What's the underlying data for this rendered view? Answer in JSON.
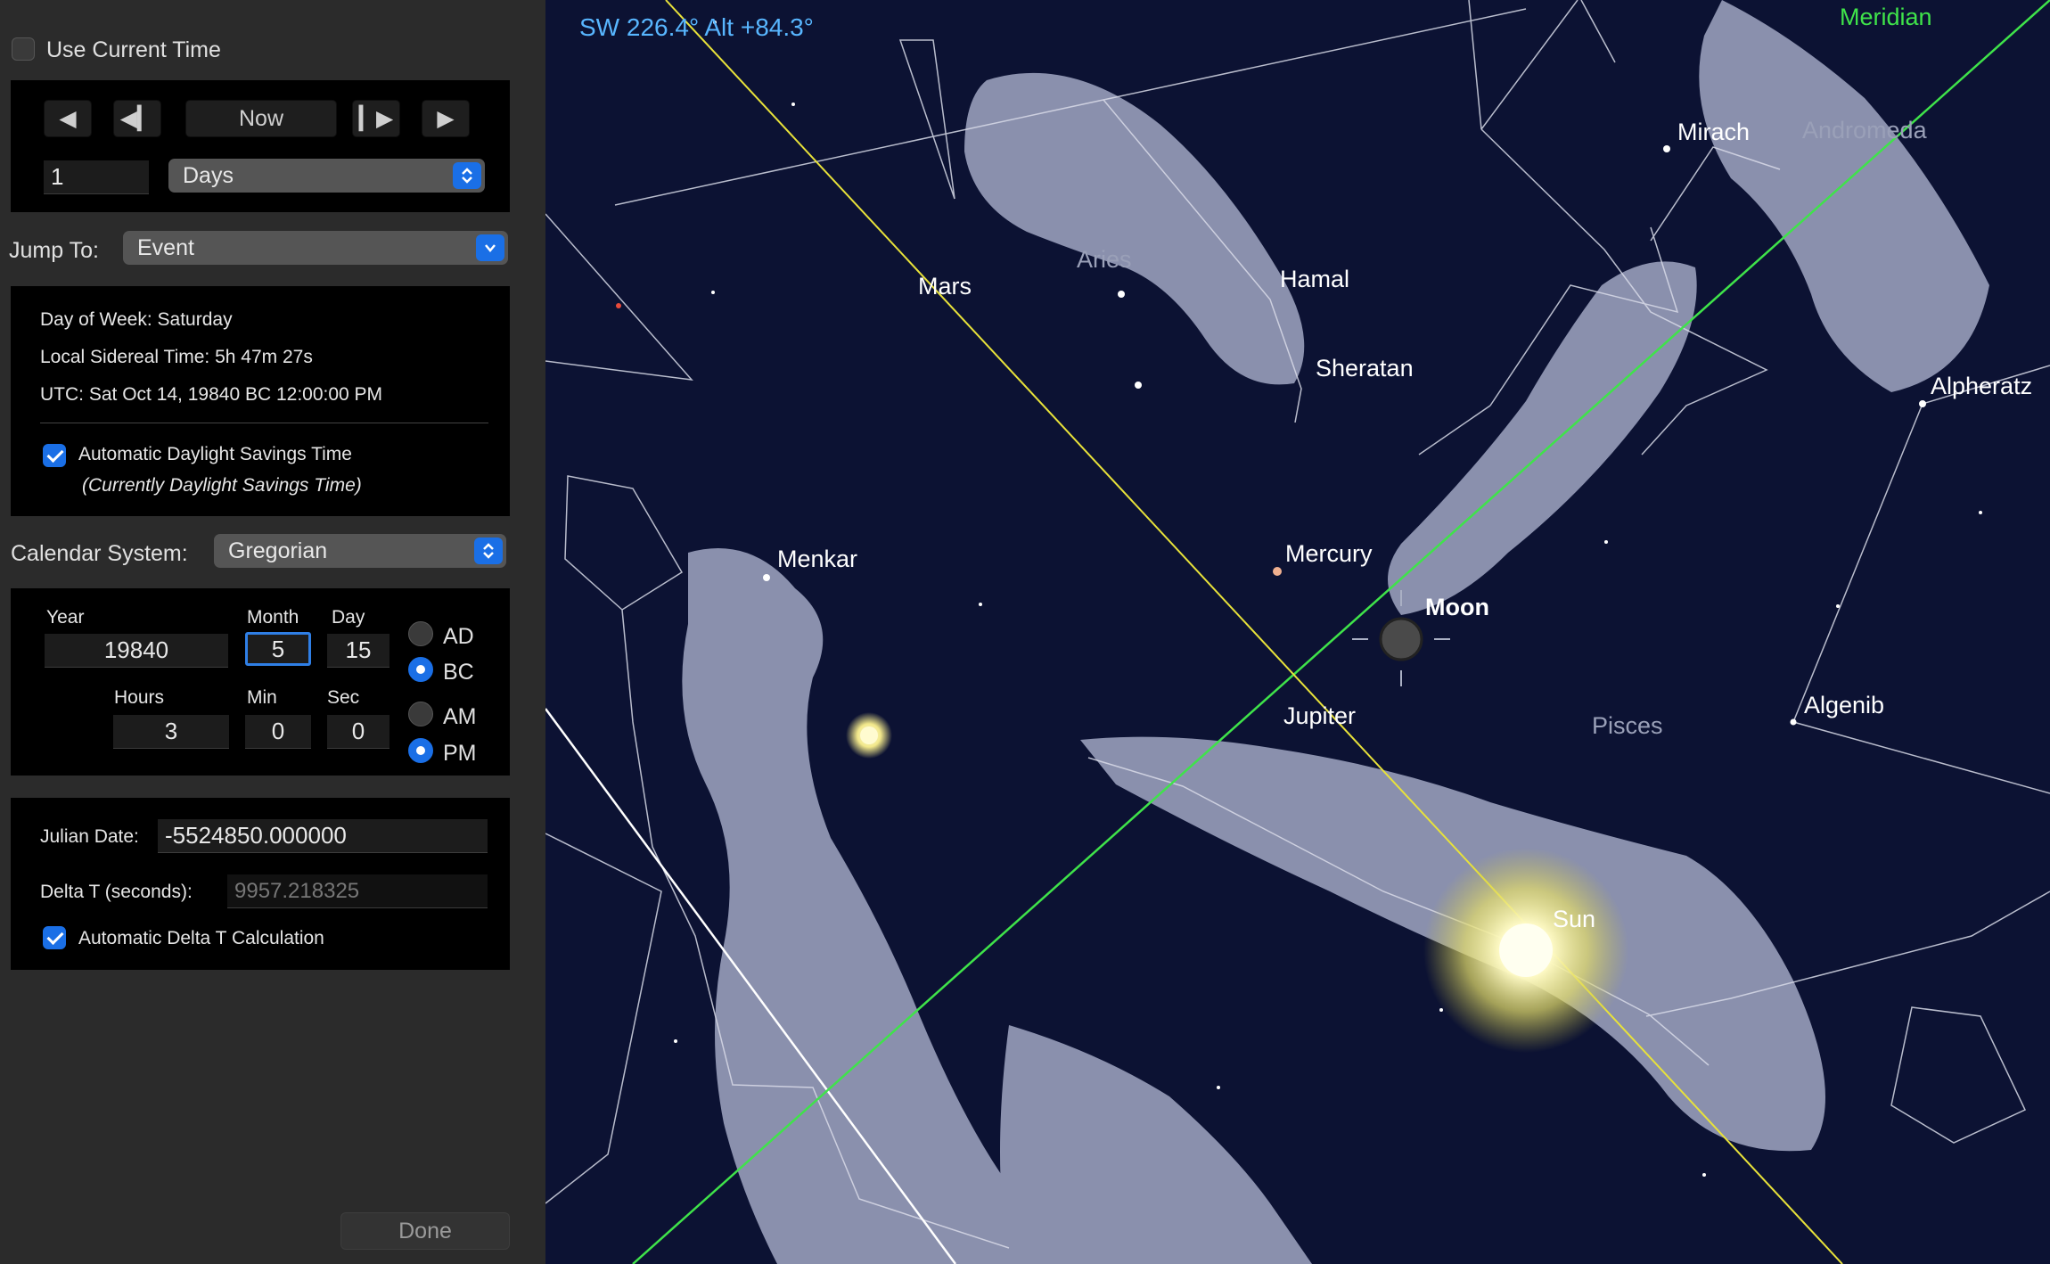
{
  "panel": {
    "use_current_time_label": "Use Current Time",
    "time_step": {
      "now_label": "Now",
      "step_value": "1",
      "unit": "Days"
    },
    "jump_to": {
      "label": "Jump To:",
      "value": "Event"
    },
    "info": {
      "day_of_week_label": "Day of Week:",
      "day_of_week_value": "Saturday",
      "sidereal_label": "Local Sidereal Time:",
      "sidereal_value": "5h 47m 27s",
      "utc_label": "UTC:",
      "utc_value": "Sat Oct 14, 19840 BC 12:00:00 PM",
      "daylight_label": "Automatic Daylight Savings Time",
      "daylight_note": "(Currently Daylight Savings Time)"
    },
    "calendar": {
      "label": "Calendar System:",
      "value": "Gregorian"
    },
    "date": {
      "year_label": "Year",
      "year": "19840",
      "month_label": "Month",
      "month": "5",
      "day_label": "Day",
      "day": "15",
      "ad_label": "AD",
      "bc_label": "BC",
      "hours_label": "Hours",
      "hours": "3",
      "min_label": "Min",
      "min": "0",
      "sec_label": "Sec",
      "sec": "0",
      "am_label": "AM",
      "pm_label": "PM"
    },
    "julian": {
      "label": "Julian Date:",
      "value": "-5524850.000000",
      "delta_label": "Delta T (seconds):",
      "delta_value": "9957.218325",
      "auto_delta_label": "Automatic Delta T Calculation"
    },
    "done_label": "Done"
  },
  "sky": {
    "readout": "SW 226.4° Alt +84.3°",
    "meridian_label": "Meridian",
    "objects": {
      "mars": "Mars",
      "aries": "Aries",
      "hamal": "Hamal",
      "sheratan": "Sheratan",
      "mirach": "Mirach",
      "andromeda": "Andromeda",
      "alpheratz": "Alpheratz",
      "menkar": "Menkar",
      "mercury": "Mercury",
      "moon": "Moon",
      "jupiter": "Jupiter",
      "pisces": "Pisces",
      "algenib": "Algenib",
      "sun": "Sun"
    },
    "colors": {
      "sky": "#0c1233",
      "meridian": "#3fe34a",
      "ecliptic": "#e8e23a",
      "readout": "#58b6ff",
      "figure": "#aab0cc"
    }
  }
}
